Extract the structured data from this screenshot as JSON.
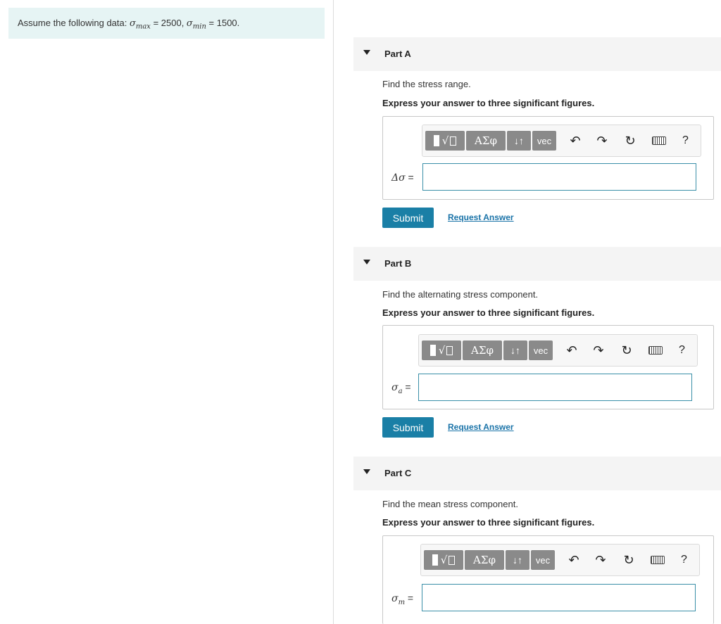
{
  "assume": {
    "prefix": "Assume the following data: ",
    "sigma": "σ",
    "max_sub": "max",
    "max_value": " = 2500, ",
    "min_sub": "min",
    "min_value": " = 1500."
  },
  "toolbar": {
    "templates_icon": "templates-sqrt-icon",
    "greek_label": "ΑΣφ",
    "arrows_label": "↓↑",
    "vec_label": "vec",
    "undo_icon": "undo-icon",
    "redo_icon": "redo-icon",
    "reset_icon": "reset-icon",
    "keyboard_icon": "keyboard-icon",
    "help_label": "?"
  },
  "parts": [
    {
      "title": "Part A",
      "question": "Find the stress range.",
      "instruction": "Express your answer to three significant figures.",
      "var_main": "Δσ",
      "var_sub": "",
      "equals": " =",
      "input_value": "",
      "submit_label": "Submit",
      "request_label": "Request Answer"
    },
    {
      "title": "Part B",
      "question": "Find the alternating stress component.",
      "instruction": "Express your answer to three significant figures.",
      "var_main": "σ",
      "var_sub": "a",
      "equals": " =",
      "input_value": "",
      "submit_label": "Submit",
      "request_label": "Request Answer"
    },
    {
      "title": "Part C",
      "question": "Find the mean stress component.",
      "instruction": "Express your answer to three significant figures.",
      "var_main": "σ",
      "var_sub": "m",
      "equals": " =",
      "input_value": ""
    }
  ],
  "colors": {
    "assume_bg": "#e6f4f4",
    "header_bg": "#f4f4f4",
    "submit_bg": "#1a7fa6",
    "link": "#1a73a8",
    "input_border": "#3a8fa8",
    "toolbar_btn": "#8a8a8a"
  }
}
